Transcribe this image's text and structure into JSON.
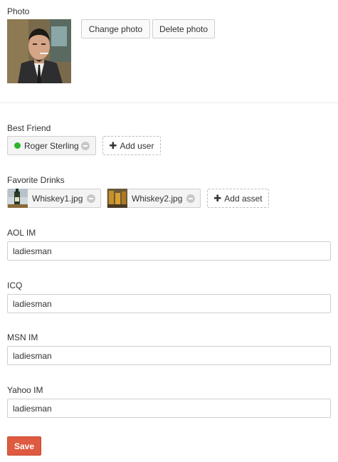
{
  "photo": {
    "label": "Photo",
    "change_label": "Change photo",
    "delete_label": "Delete photo"
  },
  "best_friend": {
    "label": "Best Friend",
    "user_name": "Roger Sterling",
    "status_color": "#2ab52a",
    "add_label": "Add user"
  },
  "favorite_drinks": {
    "label": "Favorite Drinks",
    "assets": [
      "Whiskey1.jpg",
      "Whiskey2.jpg"
    ],
    "add_label": "Add asset"
  },
  "fields": [
    {
      "label": "AOL IM",
      "value": "ladiesman"
    },
    {
      "label": "ICQ",
      "value": "ladiesman"
    },
    {
      "label": "MSN IM",
      "value": "ladiesman"
    },
    {
      "label": "Yahoo IM",
      "value": "ladiesman"
    }
  ],
  "save_label": "Save",
  "colors": {
    "save": "#de5a40",
    "online": "#2ab52a"
  }
}
